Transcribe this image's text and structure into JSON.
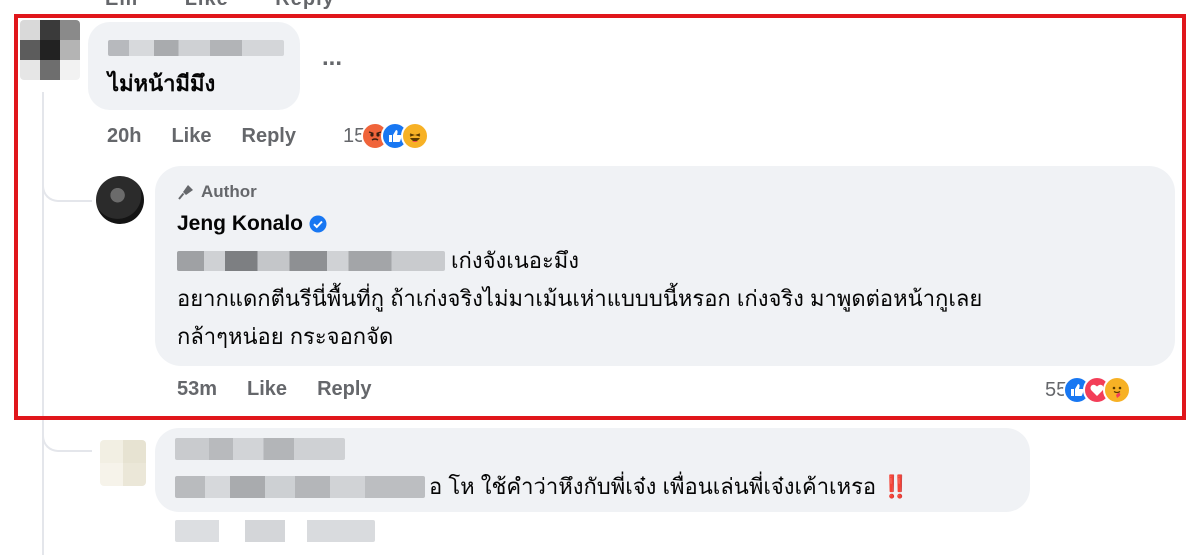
{
  "top_row": {
    "time": "Em",
    "like": "Like",
    "reply": "Reply"
  },
  "comment1": {
    "text": "ไม่หน้ามีมึง",
    "more": "...",
    "time": "20h",
    "like": "Like",
    "reply": "Reply",
    "reaction_count": "15",
    "reactions": [
      "angry-icon",
      "like-icon",
      "haha-icon"
    ]
  },
  "reply": {
    "author_tag": "Author",
    "author_name": "Jeng Konalo",
    "line1_visible": "เก่งจังเนอะมึง",
    "line2": "อยากแดกตีนรีนี่พื้นที่กู ถ้าเก่งจริงไม่มาเม้นเห่าแบบบนี้หรอก เก่งจริง มาพูดต่อหน้ากูเลย",
    "line3": "กล้าๆหน่อย กระจอกจัด",
    "time": "53m",
    "like": "Like",
    "reply": "Reply",
    "reaction_count": "55",
    "reactions": [
      "like-icon",
      "love-icon",
      "care-icon"
    ]
  },
  "comment3": {
    "text_visible": "อ โห ใช้คำว่าหึงกับพี่เจ๋ง เพื่อนเล่นพี่เจ๋งเค้าเหรอ",
    "exclaim": "‼️"
  },
  "colors": {
    "highlight": "#e0161b",
    "bubble": "#f0f2f5",
    "meta_text": "#65676b",
    "verified": "#1877f2",
    "angry": "#f0643a",
    "like": "#1877f2",
    "haha": "#f7b125",
    "love": "#f33e58"
  }
}
